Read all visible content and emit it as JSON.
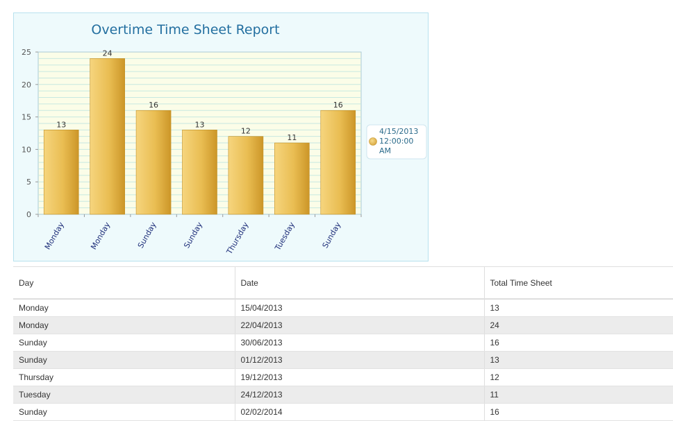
{
  "chart_data": {
    "type": "bar",
    "title": "Overtime Time Sheet Report",
    "categories": [
      "Monday",
      "Monday",
      "Sunday",
      "Sunday",
      "Thursday",
      "Tuesday",
      "Sunday"
    ],
    "series": [
      {
        "name": "4/15/2013 12:00:00 AM",
        "values": [
          13,
          24,
          16,
          13,
          12,
          11,
          16
        ]
      }
    ],
    "ylim": [
      0,
      25
    ],
    "yticks": [
      0,
      5,
      10,
      15,
      20,
      25
    ],
    "grid": true,
    "legend_position": "right",
    "data_labels": true,
    "colors": {
      "bar_light": "#f5d27a",
      "bar_dark": "#cf9a2a",
      "plot_bg": "#fbfde8",
      "grid": "#c7e8e0"
    }
  },
  "legend": {
    "lines": [
      "4/15/2013",
      "12:00:00",
      "AM"
    ]
  },
  "table": {
    "headers": [
      "Day",
      "Date",
      "Total Time Sheet"
    ],
    "rows": [
      [
        "Monday",
        "15/04/2013",
        "13"
      ],
      [
        "Monday",
        "22/04/2013",
        "24"
      ],
      [
        "Sunday",
        "30/06/2013",
        "16"
      ],
      [
        "Sunday",
        "01/12/2013",
        "13"
      ],
      [
        "Thursday",
        "19/12/2013",
        "12"
      ],
      [
        "Tuesday",
        "24/12/2013",
        "11"
      ],
      [
        "Sunday",
        "02/02/2014",
        "16"
      ]
    ]
  }
}
